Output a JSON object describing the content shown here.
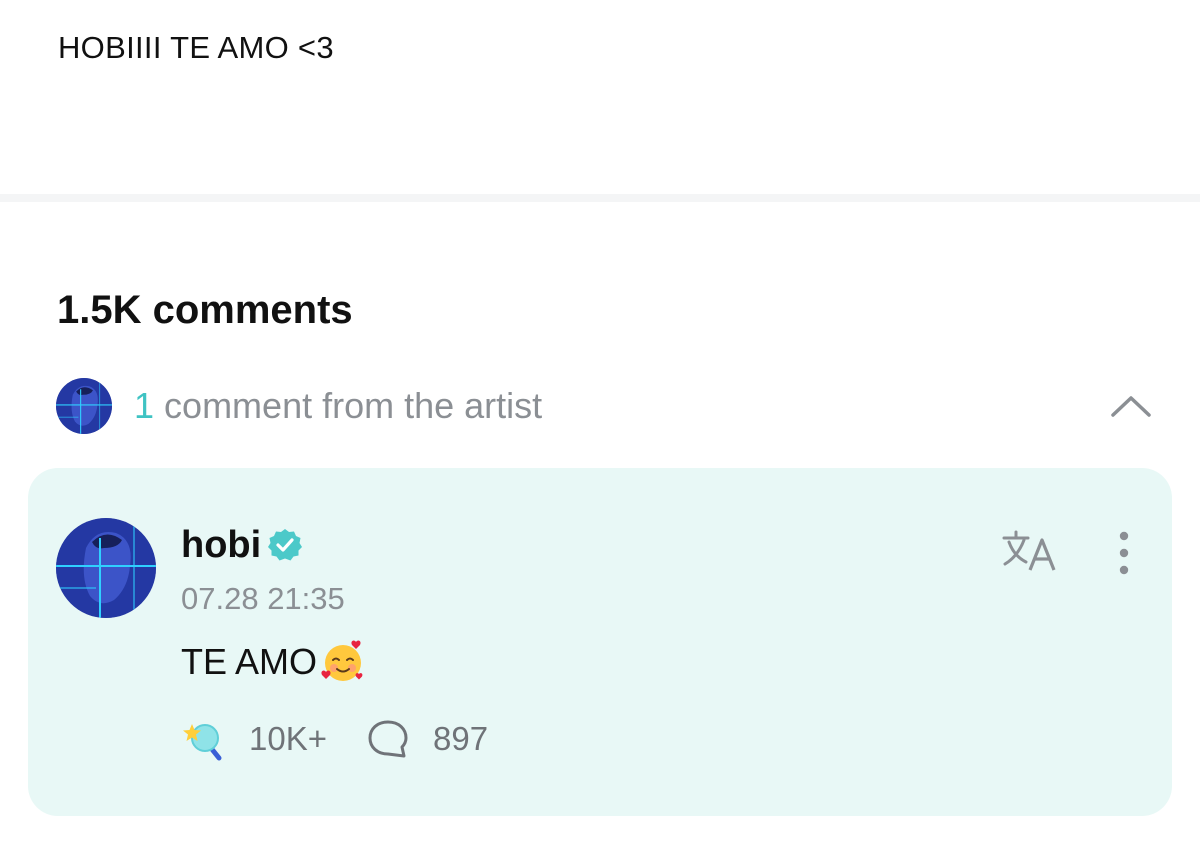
{
  "post": {
    "text": "HOBIIII TE AMO <3"
  },
  "comments": {
    "count_label": "1.5K comments",
    "artist_section": {
      "count": "1",
      "label": "comment from the artist",
      "icon": "chevron-up-icon"
    },
    "artist_comment": {
      "author": "hobi",
      "verified_icon": "verified-badge-icon",
      "timestamp": "07.28 21:35",
      "text": "TE AMO",
      "emoji": "smiling-face-with-hearts",
      "likes": "10K+",
      "replies": "897",
      "translate_icon": "translate-icon",
      "more_icon": "more-vertical-icon"
    }
  },
  "colors": {
    "accent": "#3fc3c3",
    "card_bg": "#e8f8f6",
    "muted_text": "#8b8f94"
  }
}
